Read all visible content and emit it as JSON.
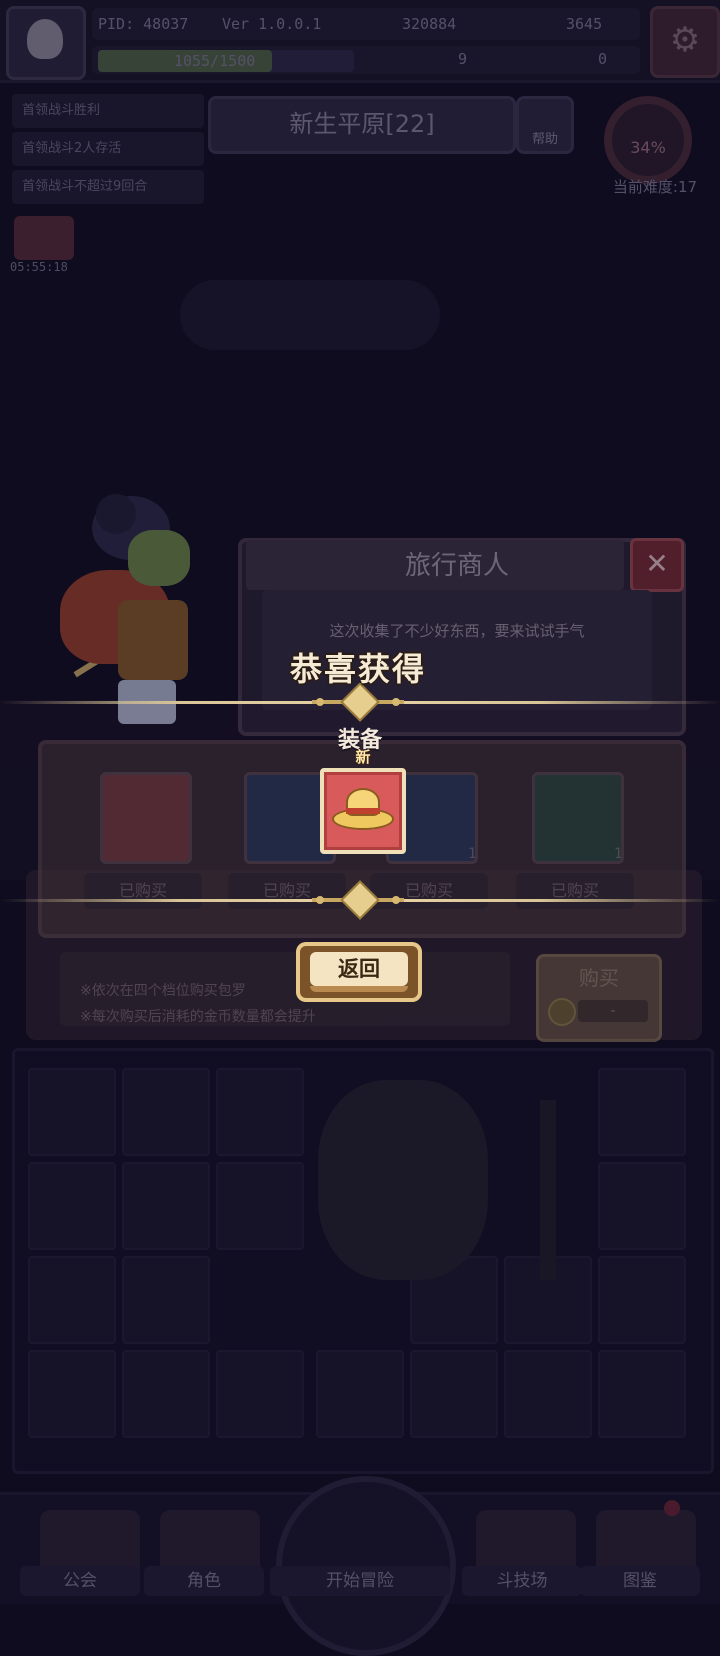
{
  "status_bar": {
    "pid": "PID: 48037",
    "version": "Ver 1.0.0.1",
    "gold": "320884",
    "gems": "3645",
    "energy": "1055/1500",
    "clover": "9",
    "keys": "0"
  },
  "quests": [
    "首领战斗胜利",
    "首领战斗2人存活",
    "首领战斗不超过9回合"
  ],
  "gift_timer": "05:55:18",
  "area": {
    "name": "新生平原[22]",
    "help_label": "帮助",
    "difficulty_percent": "34%",
    "difficulty_label": "当前难度:17"
  },
  "merchant": {
    "title": "旅行商人",
    "description": "这次收集了不少好东西，要来试试手气",
    "slots": [
      {
        "status": "已购买",
        "count": ""
      },
      {
        "status": "已购买",
        "count": "1"
      },
      {
        "status": "已购买",
        "count": ""
      },
      {
        "status": "已购买",
        "count": "1"
      }
    ],
    "rules": [
      "※依次在四个档位购买包罗",
      "※每次购买后消耗的金币数量都会提升"
    ],
    "buy_label": "购买",
    "buy_price": "-"
  },
  "reward": {
    "heading": "恭喜获得",
    "category": "装备",
    "new_badge": "新",
    "item_icon": "straw-hat-icon",
    "return_label": "返回"
  },
  "nav": {
    "guild": "公会",
    "character": "角色",
    "start": "开始冒险",
    "arena": "斗技场",
    "codex": "图鉴"
  }
}
